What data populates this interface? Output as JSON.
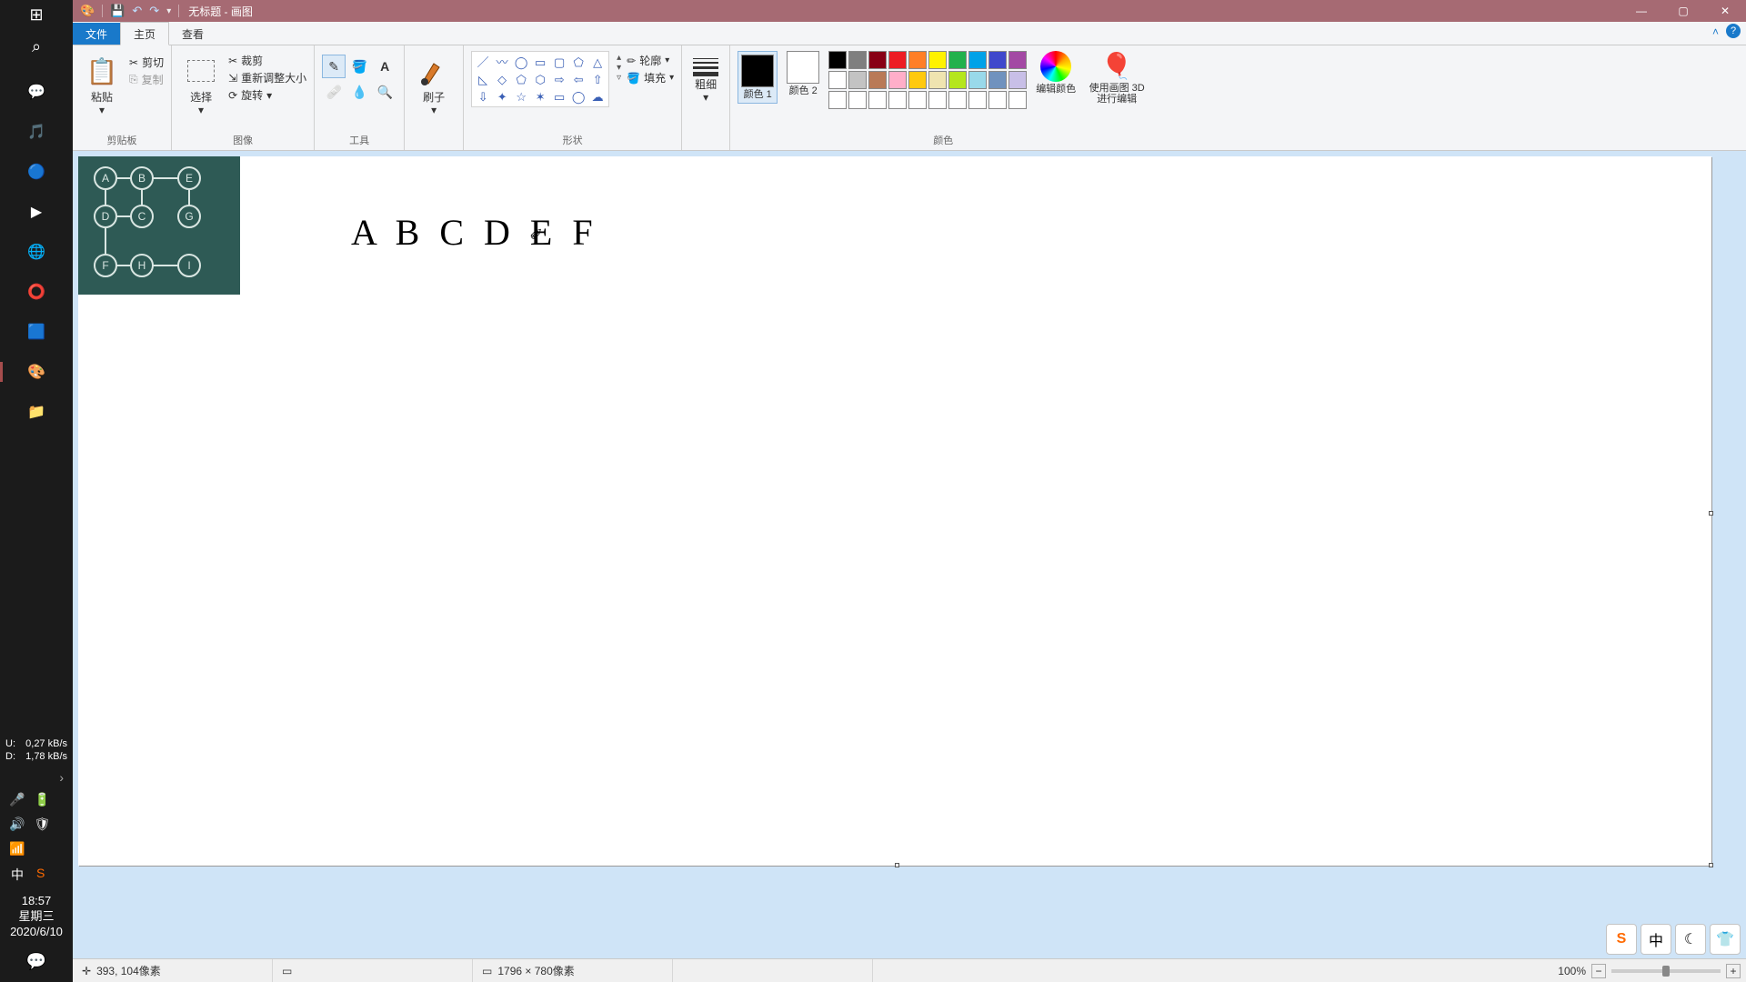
{
  "window": {
    "title": "无标题 - 画图",
    "qat": {
      "undo_tip": "撤销",
      "redo_tip": "重做",
      "save_tip": "保存"
    },
    "controls": {
      "min": "—",
      "max": "▢",
      "close": "✕"
    }
  },
  "tabs": {
    "file": "文件",
    "home": "主页",
    "view": "查看"
  },
  "ribbon": {
    "clipboard": {
      "label": "剪贴板",
      "paste": "粘贴",
      "cut": "剪切",
      "copy": "复制"
    },
    "image": {
      "label": "图像",
      "select": "选择",
      "crop": "裁剪",
      "resize": "重新调整大小",
      "rotate": "旋转"
    },
    "tools": {
      "label": "工具"
    },
    "brush": {
      "label": "刷子"
    },
    "shapes": {
      "label": "形状",
      "outline": "轮廓",
      "fill": "填充"
    },
    "size": {
      "label": "粗细"
    },
    "colors": {
      "label": "颜色",
      "color1": "颜色 1",
      "color2": "颜色 2",
      "edit": "编辑颜色",
      "paint3d": "使用画图 3D 进行编辑"
    }
  },
  "palette": {
    "row1": [
      "#000000",
      "#7f7f7f",
      "#880015",
      "#ed1c24",
      "#ff7f27",
      "#fff200",
      "#22b14c",
      "#00a2e8",
      "#3f48cc",
      "#a349a4"
    ],
    "row2": [
      "#ffffff",
      "#c3c3c3",
      "#b97a57",
      "#ffaec9",
      "#ffc90e",
      "#efe4b0",
      "#b5e61d",
      "#99d9ea",
      "#7092be",
      "#c8bfe7"
    ],
    "row3": [
      "#ffffff",
      "#ffffff",
      "#ffffff",
      "#ffffff",
      "#ffffff",
      "#ffffff",
      "#ffffff",
      "#ffffff",
      "#ffffff",
      "#ffffff"
    ]
  },
  "canvas": {
    "hand_text": "A B C D E F",
    "graph_nodes": [
      "A",
      "B",
      "E",
      "D",
      "C",
      "G",
      "F",
      "H",
      "I"
    ]
  },
  "status": {
    "cursor_pos": "393, 104像素",
    "canvas_dim": "1796 × 780像素",
    "zoom": "100%"
  },
  "taskbar": {
    "stats": {
      "u_label": "U:",
      "u_val": "0,27 kB/s",
      "d_label": "D:",
      "d_val": "1,78 kB/s"
    },
    "ime": "中",
    "clock": {
      "time": "18:57",
      "weekday": "星期三",
      "date": "2020/6/10"
    }
  },
  "ime_float": {
    "s": "S",
    "zh": "中",
    "moon": "☾",
    "shirt": "👕"
  }
}
